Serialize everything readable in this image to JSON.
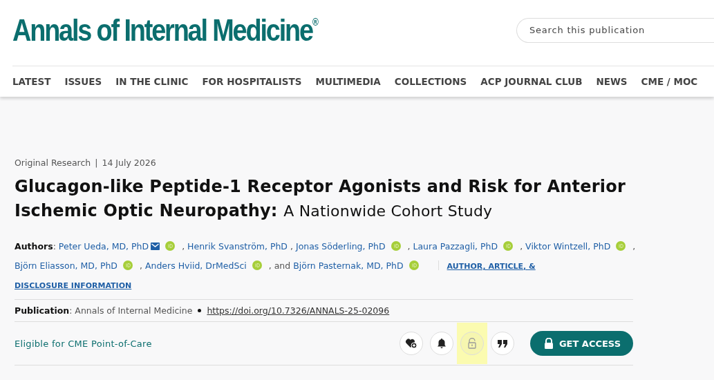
{
  "header": {
    "logo": "Annals of Internal Medicine",
    "logo_mark": "®",
    "search": {
      "placeholder": "Search this publication"
    }
  },
  "nav": [
    "LATEST",
    "ISSUES",
    "IN THE CLINIC",
    "FOR HOSPITALISTS",
    "MULTIMEDIA",
    "COLLECTIONS",
    "ACP JOURNAL CLUB",
    "NEWS",
    "CME / MOC"
  ],
  "article": {
    "type": "Original Research",
    "separator": "|",
    "date": "14 July 2026",
    "title_bold": "Glucagon-like Peptide-1 Receptor Agonists and Risk for Anterior Ischemic Optic Neuropathy:",
    "subtitle": "A Nationwide Cohort Study",
    "authors_label": "**Authors**:",
    "authors": [
      {
        "name": "Peter Ueda, MD, PhD",
        "email": true,
        "orcid": true
      },
      {
        "prefix": ",",
        "name": "Henrik Svanström, PhD",
        "email": false,
        "orcid": false
      },
      {
        "prefix": ",",
        "name": "Jonas Söderling, PhD",
        "email": false,
        "orcid": true
      },
      {
        "prefix": ",",
        "name": "Laura Pazzagli, PhD",
        "email": false,
        "orcid": true
      },
      {
        "prefix": ",",
        "name": "Viktor Wintzell, PhD",
        "email": false,
        "orcid": true
      },
      {
        "prefix": ",",
        "name": "Björn Eliasson, MD, PhD",
        "email": false,
        "orcid": true
      },
      {
        "prefix": ",",
        "name": "Anders Hviid, DrMedSci",
        "email": false,
        "orcid": true
      },
      {
        "prefix": ", and",
        "name": "Björn Pasternak, MD, PhD",
        "email": false,
        "orcid": true
      }
    ],
    "info_link": [
      "AUTHOR, ARTICLE, &",
      "DISCLOSURE INFORMATION"
    ],
    "publication": "**Publication**: Annals of Internal Medicine",
    "doi": "https://doi.org/10.7326/ANNALS-25-02096",
    "cme": "Eligible for CME Point-of-Care",
    "actions": [
      {
        "kind": "favorite",
        "highlighted": false
      },
      {
        "kind": "alert",
        "highlighted": false
      },
      {
        "kind": "unlock",
        "highlighted": true
      },
      {
        "kind": "cite",
        "highlighted": false
      }
    ],
    "access_button": "GET ACCESS"
  }
}
